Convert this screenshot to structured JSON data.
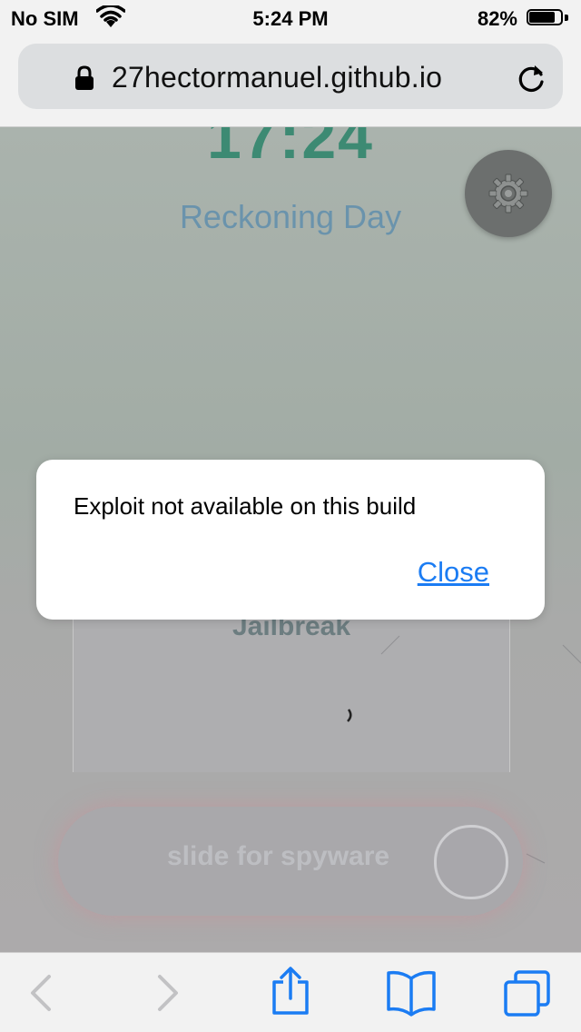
{
  "status_bar": {
    "carrier": "No SIM",
    "time": "5:24 PM",
    "battery_percent": "82%",
    "battery_level": 0.82,
    "wifi_icon": "wifi-icon"
  },
  "browser": {
    "url": "27hectormanuel.github.io",
    "lock_icon": "lock-icon",
    "reload_icon": "reload-icon"
  },
  "page": {
    "clock": "17:24",
    "day": "Reckoning Day",
    "settings_icon": "gear-icon",
    "card_title": "Jailbreak",
    "slider_text": "slide for spyware"
  },
  "alert": {
    "message": "Exploit not available on this build",
    "close_label": "Close"
  },
  "toolbar": {
    "back_icon": "chevron-left-icon",
    "forward_icon": "chevron-right-icon",
    "share_icon": "share-icon",
    "bookmarks_icon": "book-icon",
    "tabs_icon": "tabs-icon"
  },
  "colors": {
    "accent": "#1b7cf3",
    "clock": "#3d8a73",
    "day": "#6a93ac"
  }
}
